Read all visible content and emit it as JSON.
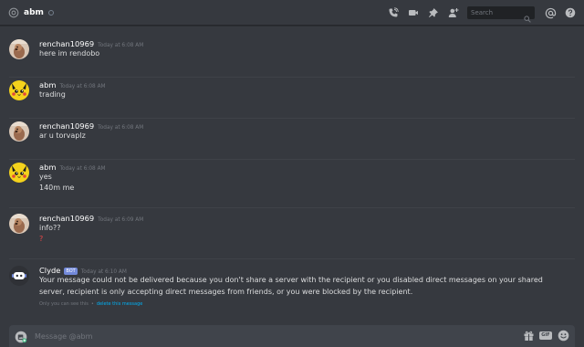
{
  "header": {
    "channel_name": "abm",
    "search_placeholder": "Search"
  },
  "messages": [
    {
      "author": "renchan10969",
      "timestamp": "Today at 6:08 AM",
      "lines": [
        "here im rendobo"
      ],
      "avatar": "dog-avatar"
    },
    {
      "author": "abm",
      "timestamp": "Today at 6:08 AM",
      "lines": [
        "trading"
      ],
      "avatar": "pikachu-avatar"
    },
    {
      "author": "renchan10969",
      "timestamp": "Today at 6:08 AM",
      "lines": [
        "ar u torvaplz"
      ],
      "avatar": "dog-avatar"
    },
    {
      "author": "abm",
      "timestamp": "Today at 6:08 AM",
      "lines": [
        "yes",
        "140m me"
      ],
      "avatar": "pikachu-avatar"
    },
    {
      "author": "renchan10969",
      "timestamp": "Today at 6:09 AM",
      "lines": [
        "info??",
        "?"
      ],
      "avatar": "dog-avatar"
    },
    {
      "author": "Clyde",
      "bot_tag": "BOT",
      "timestamp": "Today at 6:10 AM",
      "lines": [
        "Your message could not be delivered because you don't share a server with the recipient or you disabled direct messages on your shared server, recipient is only accepting direct messages from friends, or you were blocked by the recipient."
      ],
      "note": "Only you can see this",
      "note_separator": "•",
      "note_link": "delete this message",
      "avatar": "clyde-avatar"
    }
  ],
  "composer": {
    "placeholder": "Message @abm",
    "gif_label": "GIF"
  },
  "colors": {
    "background": "#36393f",
    "accent": "#7289da",
    "error": "#f04747",
    "link": "#00b0f4"
  }
}
